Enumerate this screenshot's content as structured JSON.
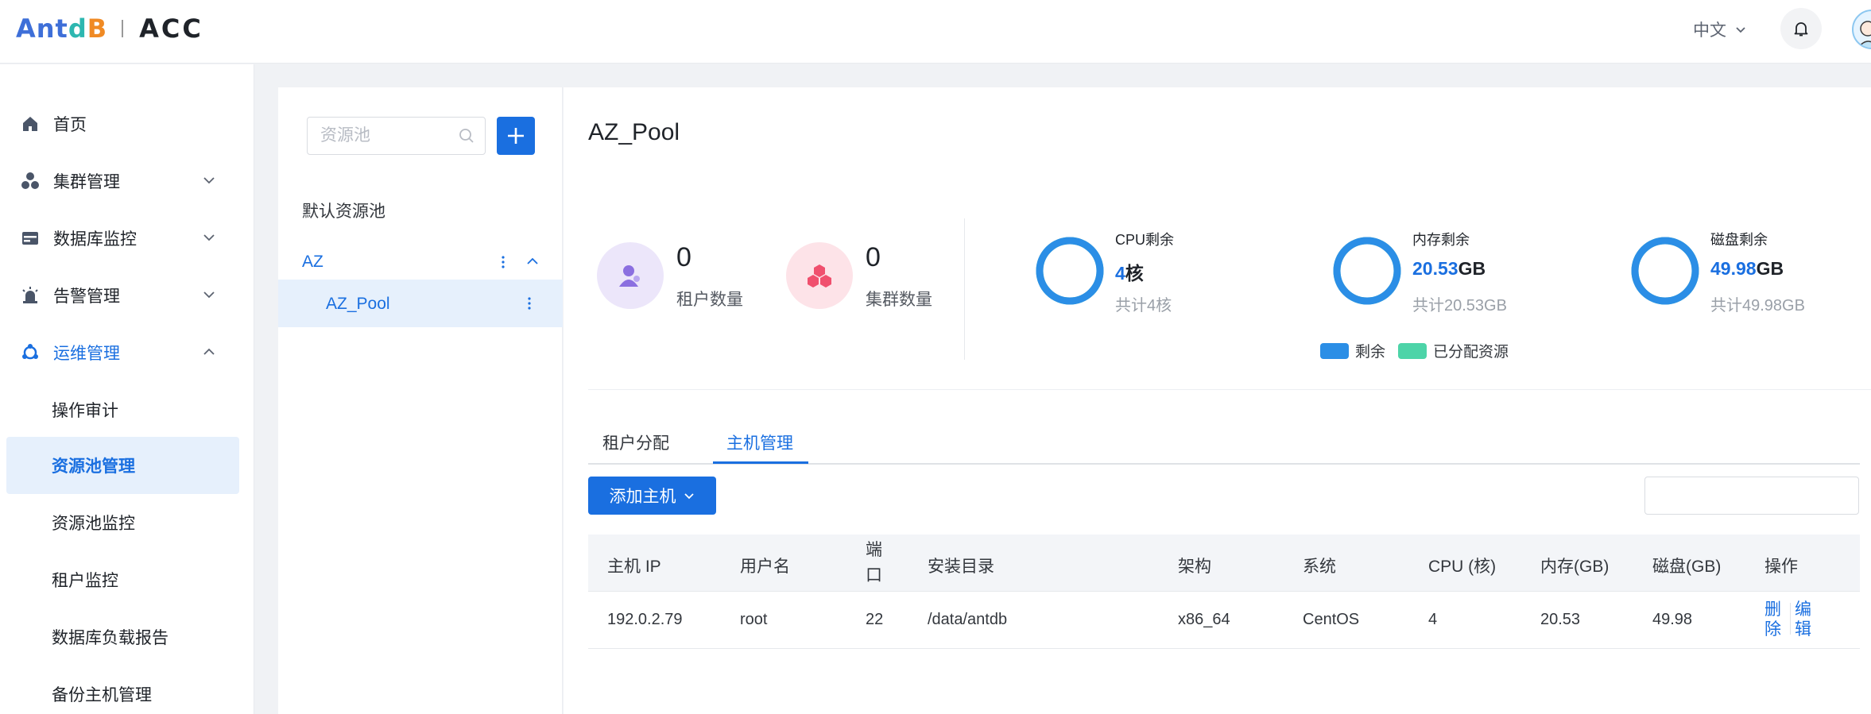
{
  "header": {
    "logo_brand": "AntDB",
    "logo_product": "ACC",
    "language": "中文"
  },
  "sidebar": {
    "items": [
      {
        "label": "首页"
      },
      {
        "label": "集群管理"
      },
      {
        "label": "数据库监控"
      },
      {
        "label": "告警管理"
      },
      {
        "label": "运维管理"
      }
    ],
    "sub_items": [
      {
        "label": "操作审计"
      },
      {
        "label": "资源池管理"
      },
      {
        "label": "资源池监控"
      },
      {
        "label": "租户监控"
      },
      {
        "label": "数据库负载报告"
      },
      {
        "label": "备份主机管理"
      }
    ]
  },
  "pool_panel": {
    "search_placeholder": "资源池",
    "default_pool": "默认资源池",
    "group": "AZ",
    "pool": "AZ_Pool"
  },
  "main": {
    "title": "AZ_Pool",
    "tenant_count": "0",
    "tenant_label": "租户数量",
    "cluster_count": "0",
    "cluster_label": "集群数量",
    "cpu": {
      "title": "CPU剩余",
      "value": "4",
      "unit": "核",
      "total": "共计4核",
      "remaining_fraction": 1.0
    },
    "memory": {
      "title": "内存剩余",
      "value": "20.53",
      "unit": "GB",
      "total": "共计20.53GB",
      "remaining_fraction": 1.0
    },
    "disk": {
      "title": "磁盘剩余",
      "value": "49.98",
      "unit": "GB",
      "total": "共计49.98GB",
      "remaining_fraction": 1.0
    },
    "legend": {
      "remaining": "剩余",
      "allocated": "已分配资源"
    },
    "colors": {
      "remaining": "#2b8ee6",
      "allocated": "#4dd4a8",
      "accent": "#1a6fe0"
    }
  },
  "tabs": [
    {
      "label": "租户分配"
    },
    {
      "label": "主机管理"
    }
  ],
  "toolbar": {
    "add_host": "添加主机"
  },
  "table": {
    "columns": [
      "主机 IP",
      "用户名",
      "端口",
      "安装目录",
      "架构",
      "系统",
      "CPU (核)",
      "内存(GB)",
      "磁盘(GB)",
      "操作"
    ],
    "port_header_line1": "端",
    "port_header_line2": "口",
    "rows": [
      {
        "ip": "192.0.2.79",
        "user": "root",
        "port": "22",
        "dir": "/data/antdb",
        "arch": "x86_64",
        "os": "CentOS",
        "cpu": "4",
        "mem": "20.53",
        "disk": "49.98",
        "delete_l1": "删",
        "delete_l2": "除",
        "edit_l1": "编",
        "edit_l2": "辑"
      }
    ]
  }
}
